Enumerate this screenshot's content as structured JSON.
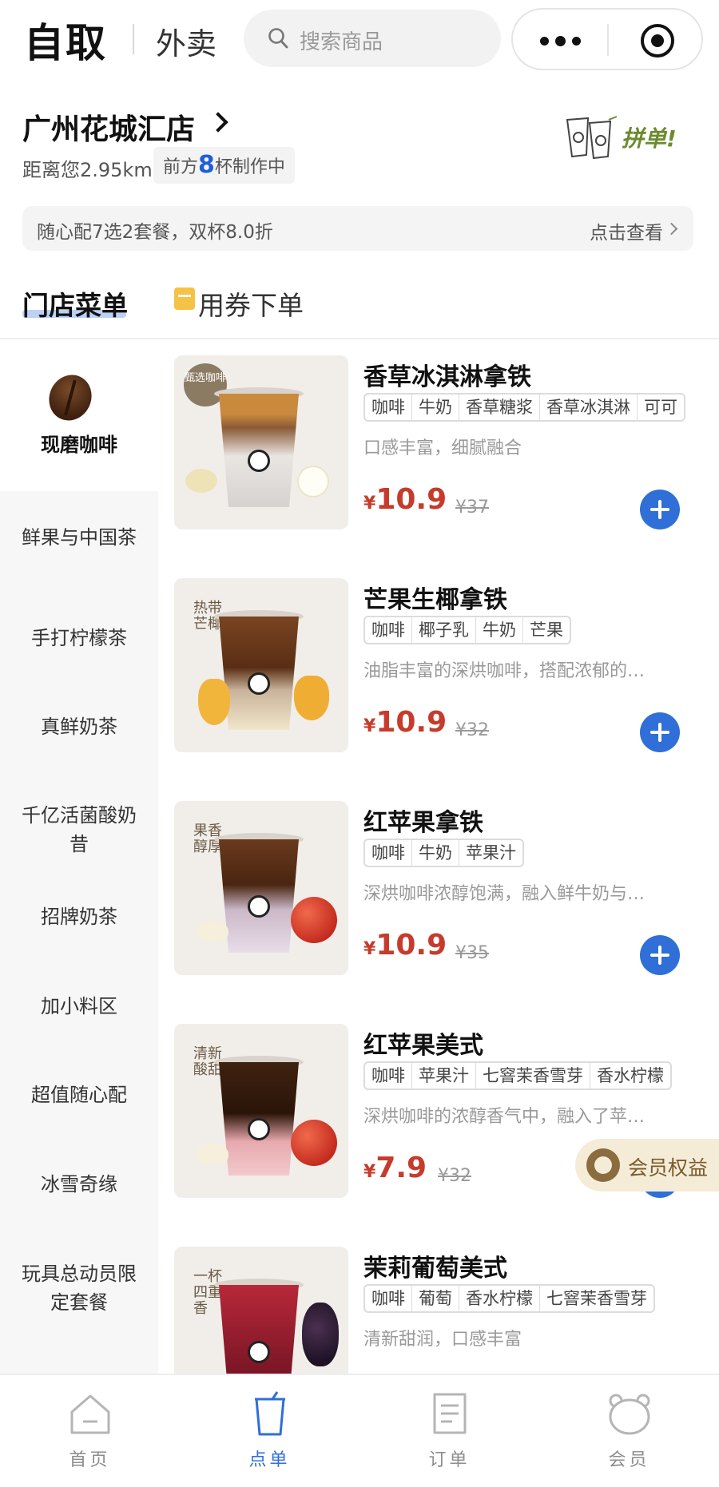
{
  "header": {
    "mode_self": "自取",
    "mode_delivery": "外卖",
    "search_placeholder": "搜索商品"
  },
  "store": {
    "name": "广州花城汇店",
    "distance": "距离您2.95km",
    "queue_prefix": "前方",
    "queue_count": "8",
    "queue_suffix": "杯制作中",
    "group_order": "拼单!"
  },
  "promo": {
    "text": "随心配7选2套餐，双杯8.0折",
    "link": "点击查看"
  },
  "tabs": {
    "menu": "门店菜单",
    "coupon": "用券下单"
  },
  "categories": [
    "现磨咖啡",
    "鲜果与中国茶",
    "手打柠檬茶",
    "真鲜奶茶",
    "千亿活菌酸奶昔",
    "招牌奶茶",
    "加小料区",
    "超值随心配",
    "冰雪奇缘",
    "玩具总动员限定套餐"
  ],
  "products": [
    {
      "name": "香草冰淇淋拿铁",
      "tags": [
        "咖啡",
        "牛奶",
        "香草糖浆",
        "香草冰淇淋",
        "可可"
      ],
      "desc": "口感丰富，细腻融合",
      "price": "10.9",
      "orig": "¥37",
      "badge": "甄选咖啡"
    },
    {
      "name": "芒果生椰拿铁",
      "tags": [
        "咖啡",
        "椰子乳",
        "牛奶",
        "芒果"
      ],
      "desc": "油脂丰富的深烘咖啡，搭配浓郁的…",
      "price": "10.9",
      "orig": "¥32",
      "badge": "热带芒椰"
    },
    {
      "name": "红苹果拿铁",
      "tags": [
        "咖啡",
        "牛奶",
        "苹果汁"
      ],
      "desc": "深烘咖啡浓醇饱满，融入鲜牛奶与…",
      "price": "10.9",
      "orig": "¥35",
      "badge": "果香醇厚"
    },
    {
      "name": "红苹果美式",
      "tags": [
        "咖啡",
        "苹果汁",
        "七窨茉香雪芽",
        "香水柠檬"
      ],
      "desc": "深烘咖啡的浓醇香气中，融入了苹…",
      "price": "7.9",
      "orig": "¥32",
      "badge": "清新酸甜"
    },
    {
      "name": "茉莉葡萄美式",
      "tags": [
        "咖啡",
        "葡萄",
        "香水柠檬",
        "七窨茉香雪芽"
      ],
      "desc": "清新甜润，口感丰富",
      "price": "",
      "orig": "",
      "badge": "一杯四重香"
    }
  ],
  "price_symbol": "¥",
  "member_badge": "会员权益",
  "tabbar": [
    {
      "label": "首页",
      "icon": "home-icon"
    },
    {
      "label": "点单",
      "icon": "cup-icon"
    },
    {
      "label": "订单",
      "icon": "receipt-icon"
    },
    {
      "label": "会员",
      "icon": "panda-icon"
    }
  ],
  "colors": {
    "accent_blue": "#2f6fd7",
    "price_red": "#c63b2b",
    "queue_blue": "#1f5ed8"
  }
}
